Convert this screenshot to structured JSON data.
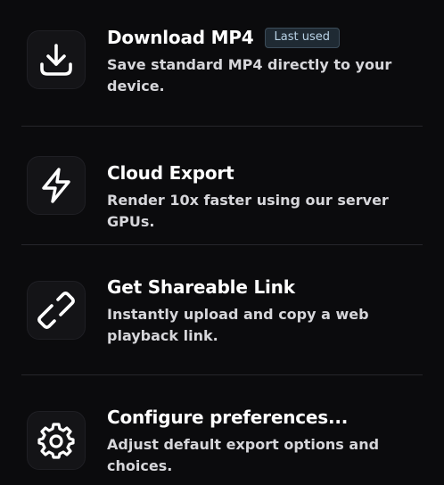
{
  "options": [
    {
      "title": "Download MP4",
      "badge": "Last used",
      "description": "Save standard MP4 directly to your device.",
      "icon": "download-icon"
    },
    {
      "title": "Cloud Export",
      "description": "Render 10x faster using our server GPUs.",
      "icon": "lightning-icon"
    },
    {
      "title": "Get Shareable Link",
      "description": "Instantly upload and copy a web playback link.",
      "icon": "link-icon"
    },
    {
      "title": "Configure preferences...",
      "description": "Adjust default export options and choices.",
      "icon": "gear-icon"
    }
  ],
  "colors": {
    "background": "#0b0b0d",
    "badge_background": "#1f2a33",
    "badge_text": "#b8d2e6"
  }
}
